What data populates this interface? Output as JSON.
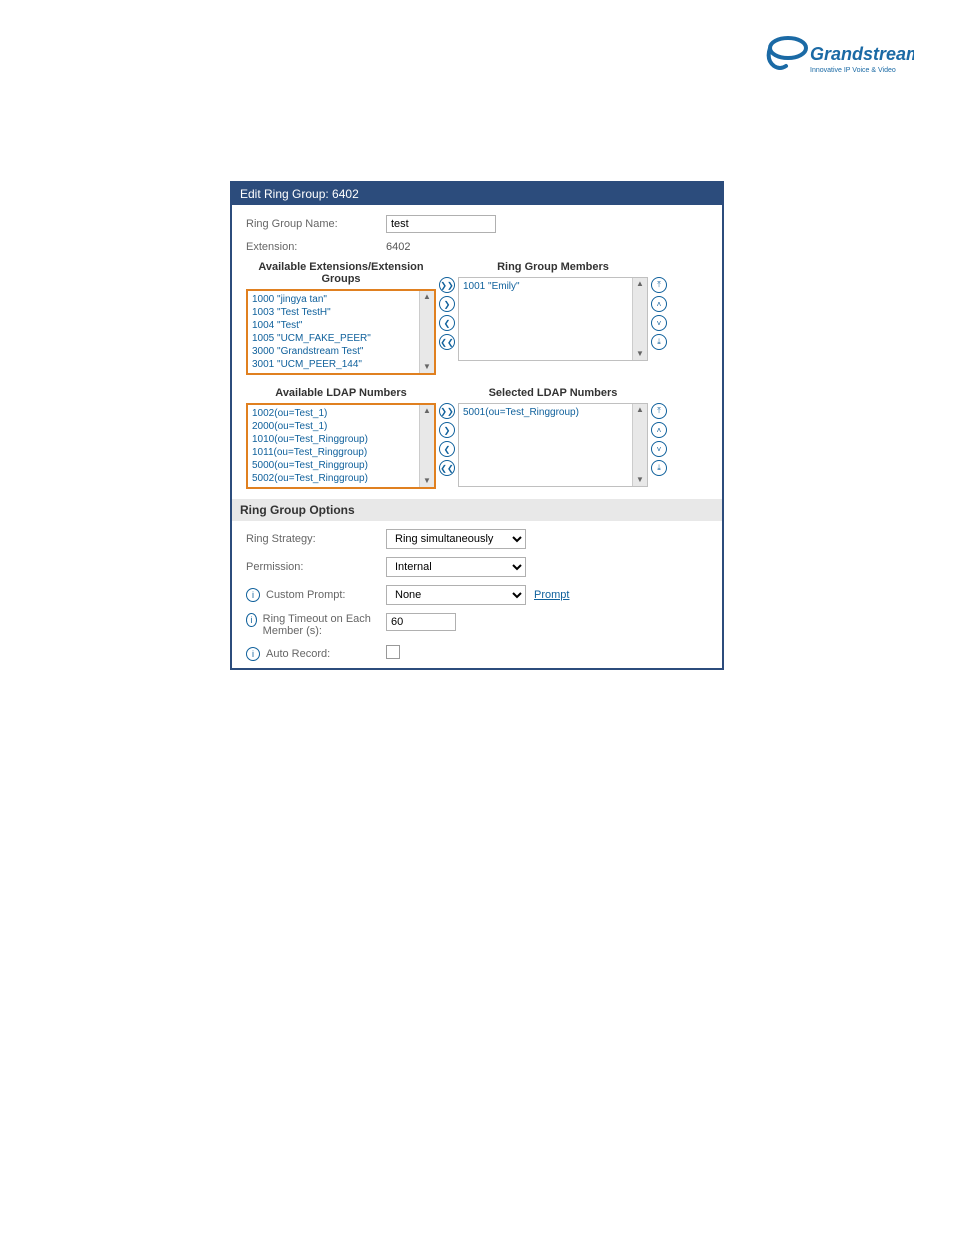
{
  "logo": {
    "brand": "Grandstream",
    "tagline": "Innovative IP Voice & Video"
  },
  "header": {
    "title": "Edit Ring Group: 6402"
  },
  "fields": {
    "ring_group_name_label": "Ring Group Name:",
    "ring_group_name_value": "test",
    "extension_label": "Extension:",
    "extension_value": "6402"
  },
  "extensions": {
    "available_title": "Available Extensions/Extension Groups",
    "members_title": "Ring Group Members",
    "available": [
      "1000 \"jingya tan\"",
      "1003 \"Test TestH\"",
      "1004 \"Test\"",
      "1005 \"UCM_FAKE_PEER\"",
      "3000 \"Grandstream Test\"",
      "3001 \"UCM_PEER_144\""
    ],
    "members": [
      "1001 \"Emily\""
    ]
  },
  "ldap": {
    "available_title": "Available LDAP Numbers",
    "selected_title": "Selected LDAP Numbers",
    "available": [
      "1002(ou=Test_1)",
      "2000(ou=Test_1)",
      "1010(ou=Test_Ringgroup)",
      "1011(ou=Test_Ringgroup)",
      "5000(ou=Test_Ringgroup)",
      "5002(ou=Test_Ringgroup)"
    ],
    "selected": [
      "5001(ou=Test_Ringgroup)"
    ]
  },
  "options": {
    "section_title": "Ring Group Options",
    "ring_strategy_label": "Ring Strategy:",
    "ring_strategy_value": "Ring simultaneously",
    "permission_label": "Permission:",
    "permission_value": "Internal",
    "custom_prompt_label": "Custom Prompt:",
    "custom_prompt_value": "None",
    "prompt_link": "Prompt",
    "ring_timeout_label": "Ring Timeout on Each Member (s):",
    "ring_timeout_value": "60",
    "auto_record_label": "Auto Record:"
  },
  "glyphs": {
    "add_all": "❯❯",
    "add_one": "❯",
    "remove_one": "❮",
    "remove_all": "❮❮",
    "up_all": "⤒",
    "up_one": "˄",
    "down_one": "˅",
    "down_all": "⤓",
    "scroll_up": "▲",
    "scroll_down": "▼"
  }
}
